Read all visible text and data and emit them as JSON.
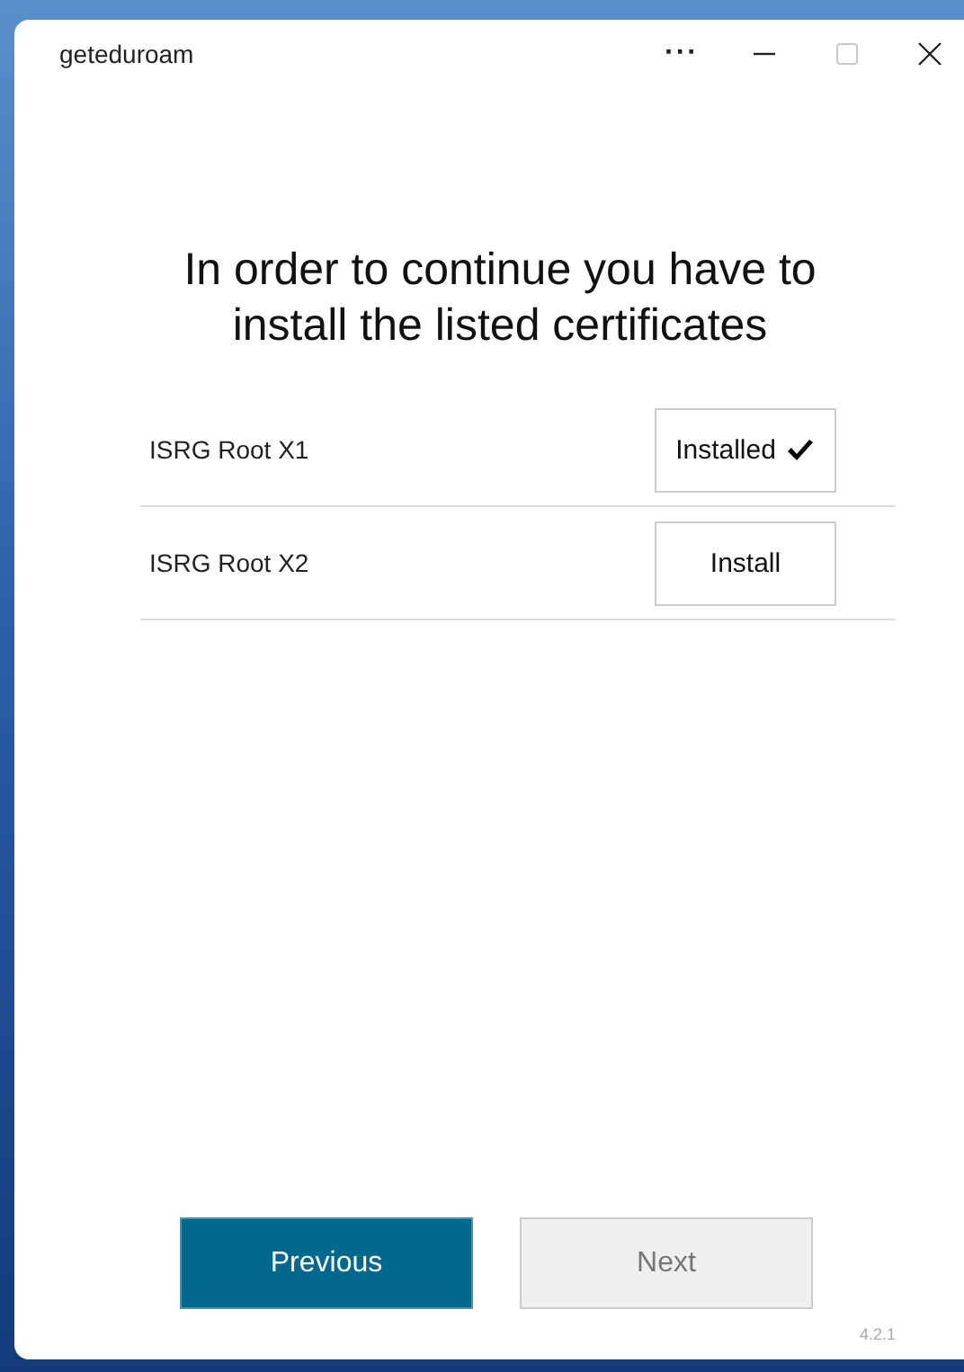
{
  "window": {
    "title": "geteduroam",
    "more_button": "···",
    "maximize_disabled": true
  },
  "heading": "In order to continue you have to install the listed certificates",
  "certificates": [
    {
      "name": "ISRG Root X1",
      "button": "Installed",
      "installed": true
    },
    {
      "name": "ISRG Root X2",
      "button": "Install",
      "installed": false
    }
  ],
  "buttons": [
    {
      "label": "Previous",
      "disabled": false
    },
    {
      "label": "Next",
      "disabled": true
    }
  ],
  "version": "4.2.1"
}
